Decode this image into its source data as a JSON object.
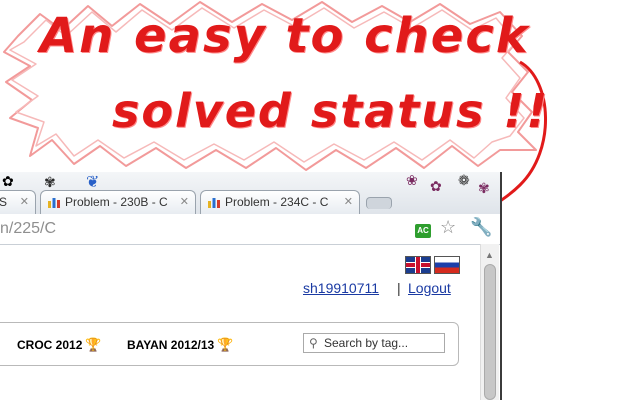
{
  "promo": {
    "line1": "An easy to check",
    "line2": "solved status !!",
    "accent_color": "#e11a1a"
  },
  "browser": {
    "tabs": [
      {
        "label": "S",
        "favicon": "chart-favicon-icon"
      },
      {
        "label": "Problem - 230B - C",
        "favicon": "chart-favicon-icon"
      },
      {
        "label": "Problem - 234C - C",
        "favicon": "chart-favicon-icon"
      }
    ],
    "close_glyph": "✕",
    "url": "n/225/C",
    "ac_badge": "AC",
    "ac_badge_color": "#2e9e2e"
  },
  "page": {
    "user": "sh19910711",
    "separator": "|",
    "logout": "Logout",
    "menu_items": [
      {
        "label": "CROC 2012"
      },
      {
        "label": "BAYAN 2012/13"
      }
    ],
    "search_placeholder": "Search by tag..."
  }
}
